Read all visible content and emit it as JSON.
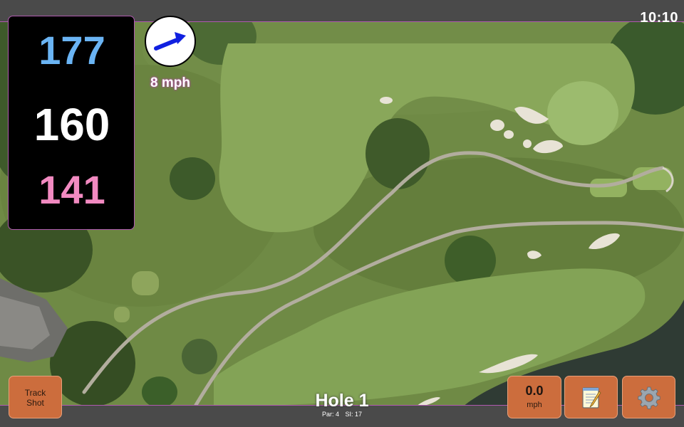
{
  "status_bar": {
    "clock": "10:10"
  },
  "yardages": {
    "back": "177",
    "center": "160",
    "front": "141"
  },
  "wind": {
    "speed": "8 mph",
    "direction_icon": "arrow-right-icon"
  },
  "hole": {
    "title": "Hole 1",
    "par": "Par: 4",
    "stroke_index": "SI: 17"
  },
  "buttons": {
    "track_shot": "Track\nShot",
    "speed_value": "0.0",
    "speed_unit": "mph",
    "notes_icon": "notepad-icon",
    "settings_icon": "gear-icon"
  },
  "colors": {
    "back_yardage": "#6ab4f4",
    "center_yardage": "#ffffff",
    "front_yardage": "#f28ac1",
    "button_bg": "#cc6d3d",
    "accent_border": "#b05ab0",
    "map_base": "#6f8a45"
  }
}
